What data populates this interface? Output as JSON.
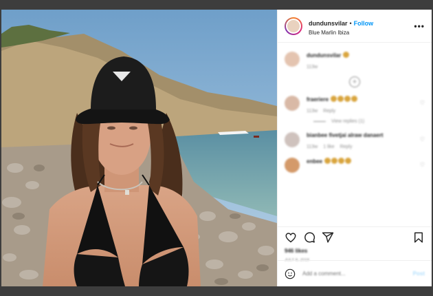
{
  "header": {
    "username": "dundunsvilar",
    "separator": "•",
    "follow_label": "Follow",
    "location": "Blue Marlin Ibiza"
  },
  "caption": {
    "username": "dundunsvilar",
    "time": "113w"
  },
  "comments": [
    {
      "username": "fraeriere",
      "time": "113w",
      "reply_label": "Reply",
      "view_replies": "View replies (1)"
    },
    {
      "username": "bianbee fivetjai alraw danaert",
      "time": "113w",
      "likes": "1 like",
      "reply_label": "Reply"
    },
    {
      "username": "enbee"
    }
  ],
  "post": {
    "likes": "946 likes",
    "date": "July 8, 2019"
  },
  "comment_box": {
    "placeholder": "Add a comment...",
    "post_label": "Post"
  },
  "colors": {
    "accent": "#0095f6",
    "text": "#262626",
    "muted": "#8e8e8e"
  },
  "icons": [
    "more-icon",
    "heart-icon",
    "comment-icon",
    "share-icon",
    "bookmark-icon",
    "smile-icon",
    "plus-circle-icon"
  ]
}
